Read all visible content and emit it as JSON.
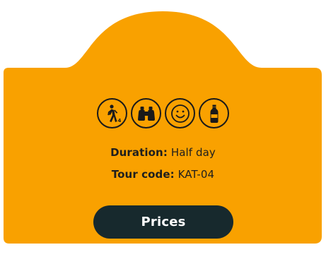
{
  "colors": {
    "card": "#f9a100",
    "outline": "#1a1a1a",
    "button": "#17292d",
    "button_text": "#ffffff"
  },
  "icons": [
    "hiking-level-icon",
    "binoculars-icon",
    "smiley-icon",
    "water-bottle-icon"
  ],
  "hiking_level": "4",
  "details": {
    "duration_label": "Duration:",
    "duration_value": "Half day",
    "tour_code_label": "Tour code:",
    "tour_code_value": "KAT-04"
  },
  "button": {
    "label": "Prices"
  }
}
